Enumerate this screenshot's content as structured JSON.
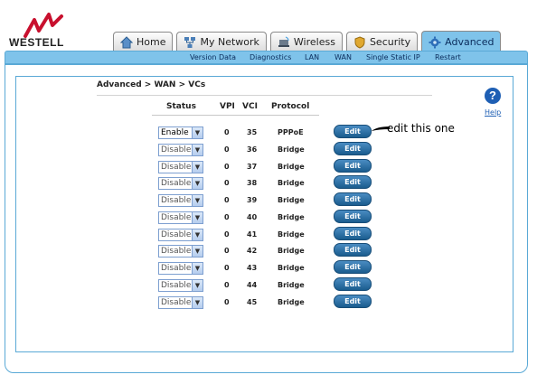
{
  "brand": {
    "logo_text": "WESTELL",
    "accent": "#7fc3ea",
    "logo_red": "#c8102e"
  },
  "tabs": [
    {
      "label": "Home",
      "icon": "home-icon"
    },
    {
      "label": "My Network",
      "icon": "network-icon"
    },
    {
      "label": "Wireless",
      "icon": "wireless-icon"
    },
    {
      "label": "Security",
      "icon": "shield-icon"
    },
    {
      "label": "Advanced",
      "icon": "gear-icon",
      "active": true
    }
  ],
  "subnav": [
    "Version Data",
    "Diagnostics",
    "LAN",
    "WAN",
    "Single Static IP",
    "Restart"
  ],
  "breadcrumb": "Advanced > WAN > VCs",
  "help": {
    "symbol": "?",
    "label": "Help"
  },
  "table": {
    "headers": [
      "Status",
      "VPI",
      "VCI",
      "Protocol"
    ],
    "rows": [
      {
        "status": "Enable",
        "vpi": "0",
        "vci": "35",
        "protocol": "PPPoE",
        "edit": "Edit"
      },
      {
        "status": "Disable",
        "vpi": "0",
        "vci": "36",
        "protocol": "Bridge",
        "edit": "Edit"
      },
      {
        "status": "Disable",
        "vpi": "0",
        "vci": "37",
        "protocol": "Bridge",
        "edit": "Edit"
      },
      {
        "status": "Disable",
        "vpi": "0",
        "vci": "38",
        "protocol": "Bridge",
        "edit": "Edit"
      },
      {
        "status": "Disable",
        "vpi": "0",
        "vci": "39",
        "protocol": "Bridge",
        "edit": "Edit"
      },
      {
        "status": "Disable",
        "vpi": "0",
        "vci": "40",
        "protocol": "Bridge",
        "edit": "Edit"
      },
      {
        "status": "Disable",
        "vpi": "0",
        "vci": "41",
        "protocol": "Bridge",
        "edit": "Edit"
      },
      {
        "status": "Disable",
        "vpi": "0",
        "vci": "42",
        "protocol": "Bridge",
        "edit": "Edit"
      },
      {
        "status": "Disable",
        "vpi": "0",
        "vci": "43",
        "protocol": "Bridge",
        "edit": "Edit"
      },
      {
        "status": "Disable",
        "vpi": "0",
        "vci": "44",
        "protocol": "Bridge",
        "edit": "Edit"
      },
      {
        "status": "Disable",
        "vpi": "0",
        "vci": "45",
        "protocol": "Bridge",
        "edit": "Edit"
      }
    ]
  },
  "annotation": "edit this one"
}
